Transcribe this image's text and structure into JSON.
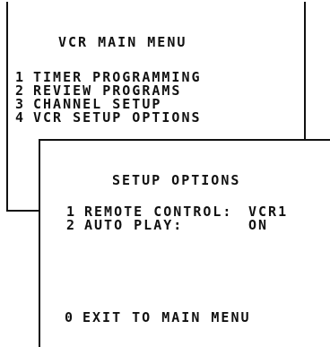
{
  "main_menu": {
    "title": "VCR MAIN MENU",
    "items": [
      {
        "num": "1",
        "label": "TIMER PROGRAMMING"
      },
      {
        "num": "2",
        "label": "REVIEW PROGRAMS"
      },
      {
        "num": "3",
        "label": "CHANNEL SETUP"
      },
      {
        "num": "4",
        "label": "VCR SETUP OPTIONS"
      }
    ]
  },
  "setup_options": {
    "title": "SETUP OPTIONS",
    "items": [
      {
        "num": "1",
        "label": "REMOTE CONTROL:",
        "value": "VCR1"
      },
      {
        "num": "2",
        "label": "AUTO PLAY:",
        "value": "ON"
      }
    ],
    "exit": {
      "num": "0",
      "label": "EXIT TO MAIN MENU"
    }
  }
}
